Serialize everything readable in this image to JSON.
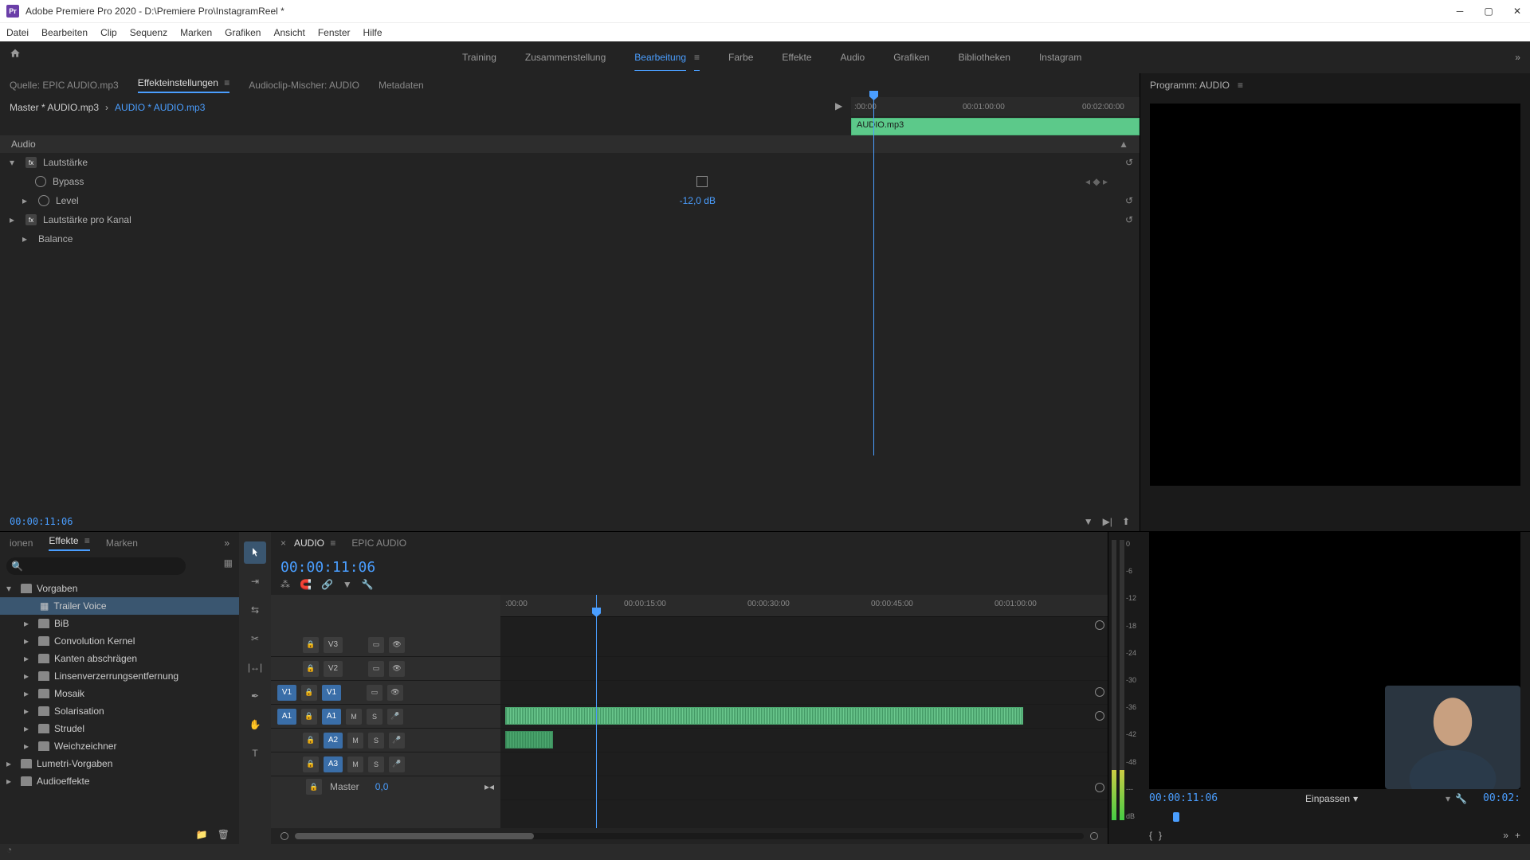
{
  "titlebar": {
    "app_icon": "Pr",
    "title": "Adobe Premiere Pro 2020 - D:\\Premiere Pro\\InstagramReel *"
  },
  "menubar": [
    "Datei",
    "Bearbeiten",
    "Clip",
    "Sequenz",
    "Marken",
    "Grafiken",
    "Ansicht",
    "Fenster",
    "Hilfe"
  ],
  "workspaces": {
    "items": [
      "Training",
      "Zusammenstellung",
      "Bearbeitung",
      "Farbe",
      "Effekte",
      "Audio",
      "Grafiken",
      "Bibliotheken",
      "Instagram"
    ],
    "active_index": 2
  },
  "source_tabs": {
    "items": [
      "Quelle: EPIC AUDIO.mp3",
      "Effekteinstellungen",
      "Audioclip-Mischer: AUDIO",
      "Metadaten"
    ],
    "active_index": 1
  },
  "effect_controls": {
    "master_label": "Master * AUDIO.mp3",
    "clip_label": "AUDIO * AUDIO.mp3",
    "section": "Audio",
    "clip_bar_name": "AUDIO.mp3",
    "ruler_ticks": [
      ":00:00",
      "00:01:00:00",
      "00:02:00:00"
    ],
    "props": {
      "volume_label": "Lautstärke",
      "bypass_label": "Bypass",
      "level_label": "Level",
      "level_value": "-12,0 dB",
      "channel_volume_label": "Lautstärke pro Kanal",
      "balance_label": "Balance"
    },
    "timecode": "00:00:11:06"
  },
  "project_panel": {
    "tabs": [
      "ionen",
      "Effekte",
      "Marken"
    ],
    "active_tab_index": 1,
    "search_placeholder": "",
    "tree": [
      {
        "label": "Vorgaben",
        "type": "folder",
        "expanded": true
      },
      {
        "label": "Trailer Voice",
        "type": "child",
        "selected": true
      },
      {
        "label": "BiB",
        "type": "folder"
      },
      {
        "label": "Convolution Kernel",
        "type": "folder"
      },
      {
        "label": "Kanten abschrägen",
        "type": "folder"
      },
      {
        "label": "Linsenverzerrungsentfernung",
        "type": "folder"
      },
      {
        "label": "Mosaik",
        "type": "folder"
      },
      {
        "label": "Solarisation",
        "type": "folder"
      },
      {
        "label": "Strudel",
        "type": "folder"
      },
      {
        "label": "Weichzeichner",
        "type": "folder"
      },
      {
        "label": "Lumetri-Vorgaben",
        "type": "folder"
      },
      {
        "label": "Audioeffekte",
        "type": "folder"
      }
    ]
  },
  "timeline": {
    "tabs": [
      "AUDIO",
      "EPIC AUDIO"
    ],
    "active_tab_index": 0,
    "timecode": "00:00:11:06",
    "ruler_ticks": [
      ":00:00",
      "00:00:15:00",
      "00:00:30:00",
      "00:00:45:00",
      "00:01:00:00"
    ],
    "video_tracks": [
      "V3",
      "V2",
      "V1"
    ],
    "audio_tracks": [
      "A1",
      "A2",
      "A3"
    ],
    "master_label": "Master",
    "master_value": "0,0",
    "source_patches": {
      "v": "V1",
      "a": "A1"
    }
  },
  "audio_meters": {
    "scale": [
      "0",
      "-6",
      "-12",
      "-18",
      "-24",
      "-30",
      "-36",
      "-42",
      "-48",
      "---",
      "dB"
    ]
  },
  "program": {
    "header": "Programm: AUDIO",
    "timecode": "00:00:11:06",
    "fit_label": "Einpassen",
    "duration": "00:02:"
  }
}
